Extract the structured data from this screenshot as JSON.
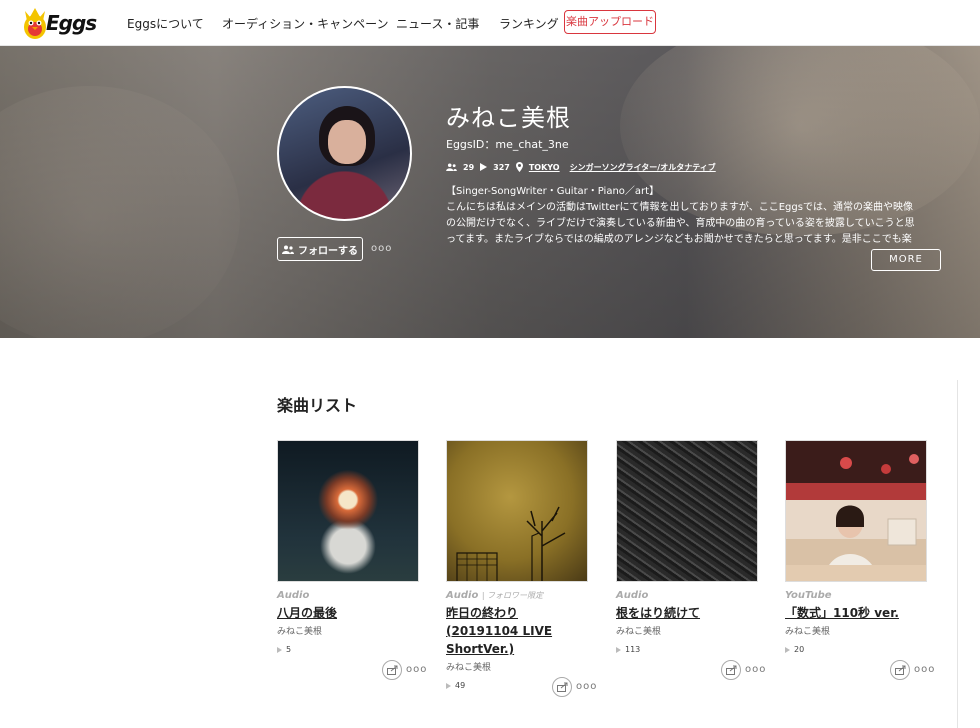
{
  "header": {
    "logo_text": "Eggs",
    "nav": [
      "Eggsについて",
      "オーディション・キャンペーン",
      "ニュース・記事",
      "ランキング"
    ],
    "upload_label": "楽曲アップロード"
  },
  "profile": {
    "name": "みねこ美根",
    "eggs_id": "EggsID：me_chat_3ne",
    "followers": "29",
    "plays": "327",
    "location": "TOKYO",
    "genre": "シンガーソングライター/オルタナティブ",
    "bio_line1": "【Singer-SongWriter・Guitar・Piano／art】",
    "bio_line2": "こんにちは私はメインの活動はTwitterにて情報を出しておりますが、ここEggsでは、通常の楽曲や映像",
    "bio_line3": "の公開だけでなく、ライブだけで演奏している新曲や、育成中の曲の育っている姿を披露していこうと思",
    "bio_line4": "ってます。またライブならではの編成のアレンジなどもお聞かせできたらと思ってます。是非ここでも楽",
    "follow_label": "フォローする",
    "more_label": "MORE",
    "dots": "ooo"
  },
  "songs": {
    "section_title": "楽曲リスト",
    "items": [
      {
        "type": "Audio",
        "type_note": "",
        "title": "八月の最後",
        "artist": "みねこ美根",
        "plays": "5"
      },
      {
        "type": "Audio",
        "type_note": "| フォロワー限定",
        "title": "昨日の終わり(20191104 LIVE ShortVer.)",
        "artist": "みねこ美根",
        "plays": "49"
      },
      {
        "type": "Audio",
        "type_note": "",
        "title": "根をはり続けて",
        "artist": "みねこ美根",
        "plays": "113"
      },
      {
        "type": "YouTube",
        "type_note": "",
        "title": "「数式」110秒 ver.",
        "artist": "みねこ美根",
        "plays": "20"
      }
    ],
    "dots": "ooo"
  },
  "colors": {
    "accent": "#d9363e",
    "logo_yellow": "#f3c400"
  }
}
